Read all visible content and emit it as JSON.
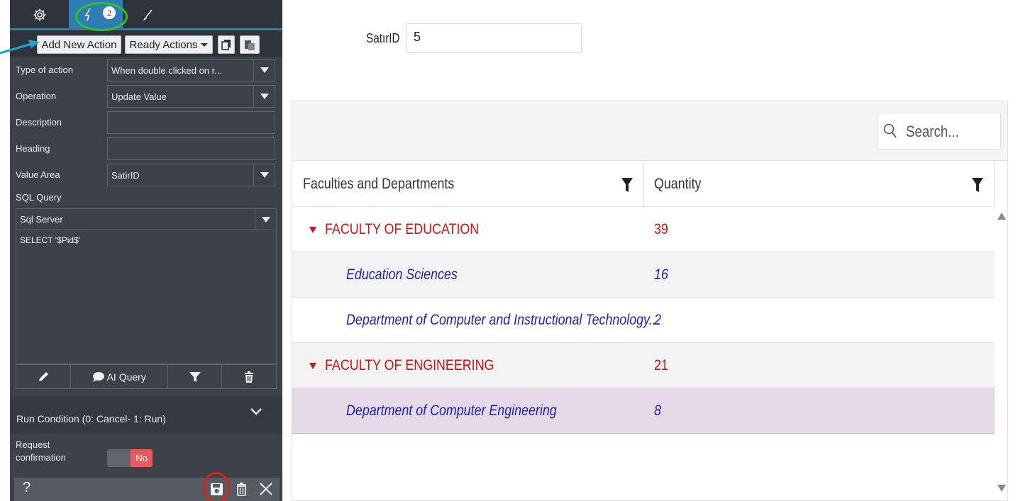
{
  "panel": {
    "tabs": [
      {
        "name": "settings",
        "icon": "gear-icon"
      },
      {
        "name": "actions",
        "icon": "lightning-icon",
        "badge": "2"
      },
      {
        "name": "style",
        "icon": "brush-icon"
      }
    ],
    "toolbar": {
      "add_label": "Add New Action",
      "ready_label": "Ready Actions"
    },
    "fields": {
      "type_label": "Type of action",
      "type_value": "When double clicked on r...",
      "operation_label": "Operation",
      "operation_value": "Update Value",
      "description_label": "Description",
      "description_value": "",
      "heading_label": "Heading",
      "heading_value": "",
      "value_area_label": "Value Area",
      "value_area_value": "SatirID",
      "sql_label": "SQL Query",
      "sql_engine": "Sql Server",
      "sql_text": "SELECT '$Pid$'"
    },
    "sql_tools": {
      "ai_query_label": "AI Query"
    },
    "run_condition_label": "Run Condition (0: Cancel- 1: Run)",
    "request_confirmation_label": "Request confirmation",
    "request_confirmation_value": "No",
    "bottom": {
      "help_label": "?"
    }
  },
  "satir": {
    "label": "SatırID",
    "value": "5"
  },
  "grid": {
    "search_placeholder": "Search...",
    "columns": [
      "Faculties and Departments",
      "Quantity"
    ],
    "rows": [
      {
        "level": "group",
        "name": "FACULTY OF EDUCATION",
        "quantity": "39"
      },
      {
        "level": "item",
        "name": "Education Sciences",
        "quantity": "16"
      },
      {
        "level": "item",
        "name": "Department of Computer and Instructional Technology...",
        "quantity": "2"
      },
      {
        "level": "group",
        "name": "FACULTY OF ENGINEERING",
        "quantity": "21"
      },
      {
        "level": "item",
        "name": "Department of Computer Engineering",
        "quantity": "8",
        "selected": true
      }
    ]
  },
  "colors": {
    "panel_bg": "#3d4249",
    "accent_blue": "#2f7db6",
    "group_text": "#d21414",
    "item_text": "#1c1fb7",
    "selected_row": "#e6d9e8",
    "alt_row": "#f3f3f3",
    "toggle_no": "#ea5a5a",
    "highlight_green": "#29c52f",
    "highlight_red": "#d9231a",
    "annotation_arrow": "#1aa3d4"
  }
}
